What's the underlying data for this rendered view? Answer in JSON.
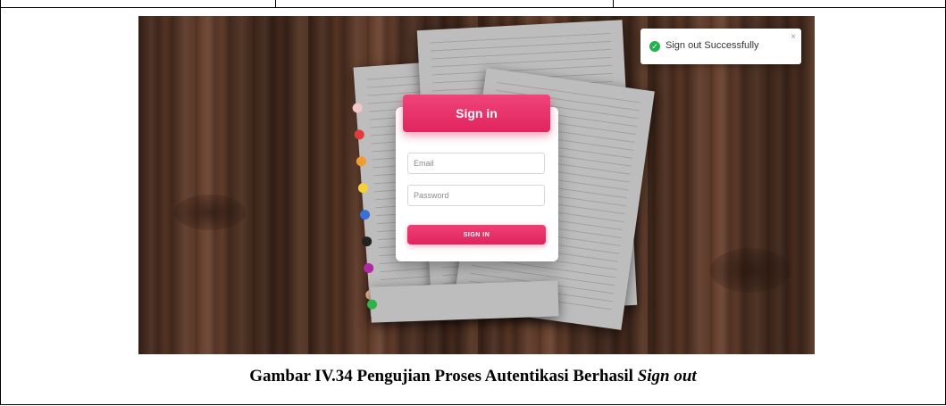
{
  "login": {
    "header_title": "Sign in",
    "email_placeholder": "Email",
    "password_placeholder": "Password",
    "submit_label": "SIGN IN"
  },
  "toast": {
    "message": "Sign out Successfully",
    "close_glyph": "×",
    "check_glyph": "✓",
    "status_color": "#22b14c"
  },
  "caption": {
    "prefix": "Gambar IV.34 Pengujian Proses Autentikasi Berhasil ",
    "emphasis": "Sign out"
  },
  "theme": {
    "accent": "#e0245e"
  }
}
